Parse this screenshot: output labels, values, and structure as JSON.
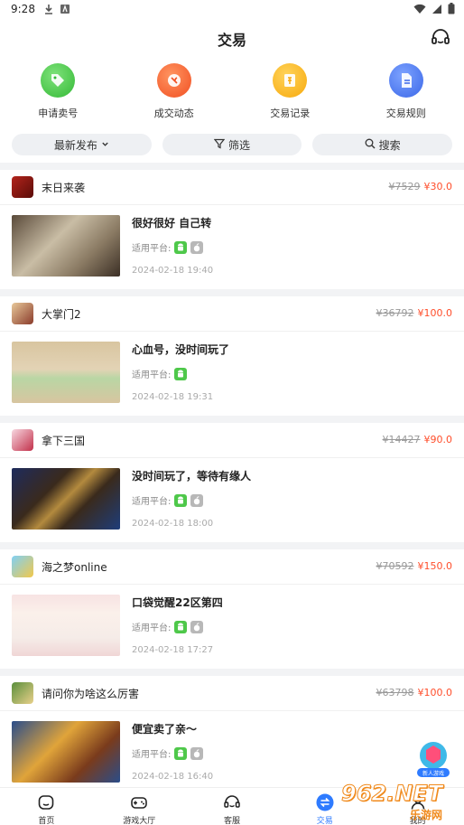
{
  "status_bar": {
    "time": "9:28"
  },
  "header": {
    "title": "交易"
  },
  "shortcuts": [
    {
      "label": "申请卖号",
      "color": "#4fcf4f"
    },
    {
      "label": "成交动态",
      "color": "#ff6a3d"
    },
    {
      "label": "交易记录",
      "color": "#ffb21e"
    },
    {
      "label": "交易规则",
      "color": "#4a7cf2"
    }
  ],
  "filters": {
    "sort": "最新发布",
    "filter": "筛选",
    "search": "搜索"
  },
  "listings": [
    {
      "game": "末日来袭",
      "old_price": "¥7529",
      "price": "¥30.0",
      "title": "很好很好 自己转",
      "platform_label": "适用平台:",
      "date": "2024-02-18 19:40"
    },
    {
      "game": "大掌门2",
      "old_price": "¥36792",
      "price": "¥100.0",
      "title": "心血号，没时间玩了",
      "platform_label": "适用平台:",
      "date": "2024-02-18 19:31"
    },
    {
      "game": "拿下三国",
      "old_price": "¥14427",
      "price": "¥90.0",
      "title": "没时间玩了，等待有缘人",
      "platform_label": "适用平台:",
      "date": "2024-02-18 18:00"
    },
    {
      "game": "海之梦online",
      "old_price": "¥70592",
      "price": "¥150.0",
      "title": "口袋觉醒22区第四",
      "platform_label": "适用平台:",
      "date": "2024-02-18 17:27"
    },
    {
      "game": "请问你为啥这么厉害",
      "old_price": "¥63798",
      "price": "¥100.0",
      "title": "便宜卖了亲～",
      "platform_label": "适用平台:",
      "date": "2024-02-18 16:40"
    }
  ],
  "bottom_nav": [
    {
      "label": "首页",
      "icon": "home-icon",
      "active": false
    },
    {
      "label": "游戏大厅",
      "icon": "gamepad-icon",
      "active": false
    },
    {
      "label": "客服",
      "icon": "headset-icon",
      "active": false
    },
    {
      "label": "交易",
      "icon": "exchange-icon",
      "active": true
    },
    {
      "label": "我的",
      "icon": "user-icon",
      "active": false
    }
  ],
  "float_badge": {
    "label": "新人游戏"
  },
  "watermark": {
    "text": "962.NET",
    "subtext": "乐游网"
  },
  "colors": {
    "accent": "#2e7bff",
    "price": "#ff4e2b"
  }
}
